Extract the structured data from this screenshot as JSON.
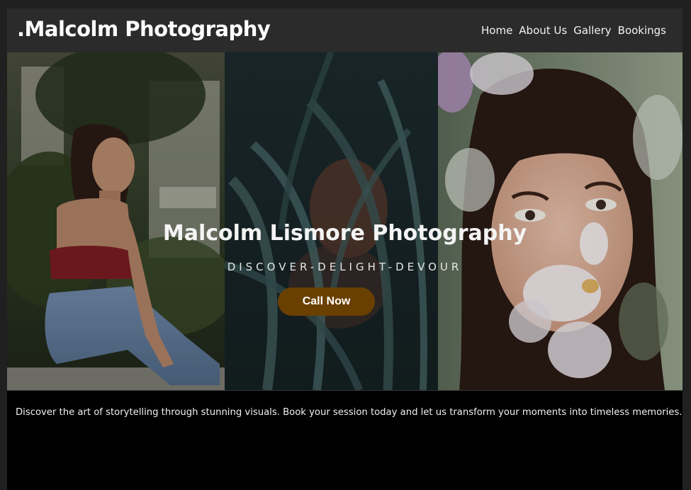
{
  "header": {
    "brand": ".Malcolm Photography",
    "nav": [
      {
        "label": "Home"
      },
      {
        "label": "About Us"
      },
      {
        "label": "Gallery"
      },
      {
        "label": "Bookings"
      }
    ]
  },
  "hero": {
    "title": "Malcolm Lismore Photography",
    "tagline": "DISCOVER-DELIGHT-DEVOUR",
    "cta_label": "Call Now",
    "photos": [
      "woman-on-bench-photo",
      "woman-behind-leaves-photo",
      "woman-with-flowers-photo"
    ]
  },
  "footer": {
    "description": "Discover the art of storytelling through stunning visuals. Book your session today and let us transform your moments into timeless memories."
  },
  "colors": {
    "page_background": "#000000",
    "navbar_background": "#2b2b2b",
    "cta_background": "#694000",
    "text": "#ffffff"
  }
}
